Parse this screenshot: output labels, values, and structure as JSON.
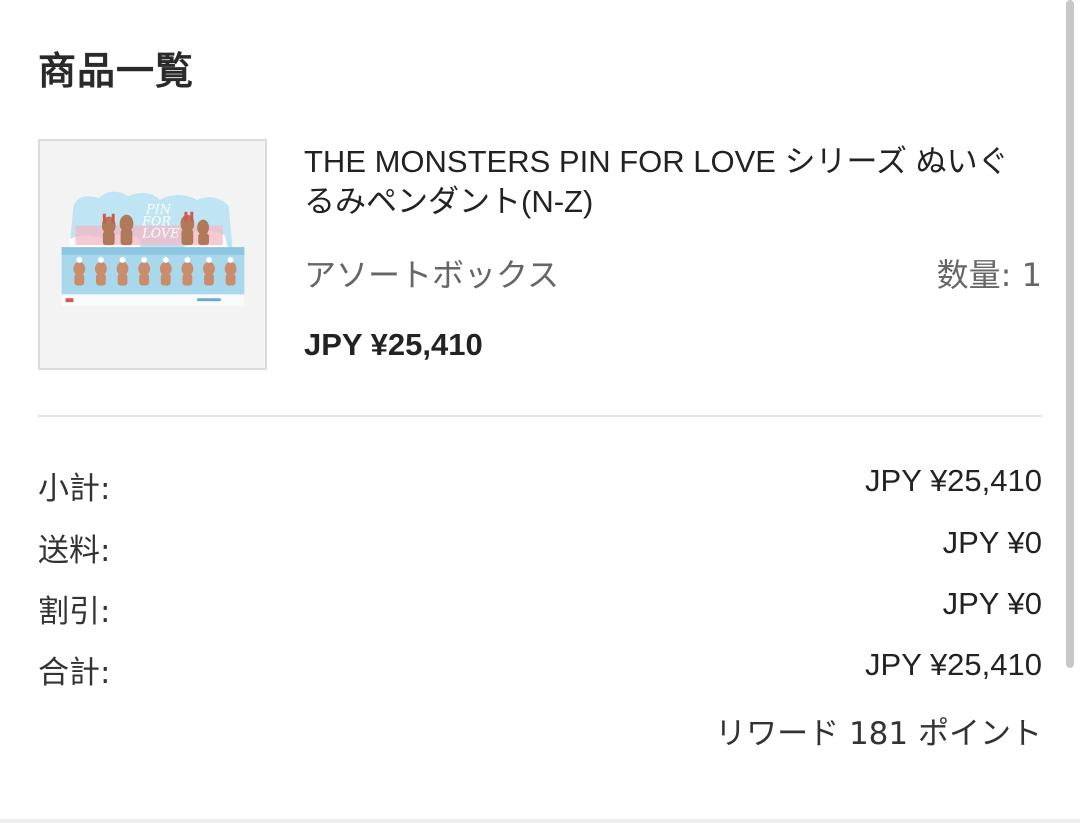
{
  "section": {
    "title": "商品一覧"
  },
  "product": {
    "image": {
      "box_text_1": "PIN",
      "box_text_2": "FOR",
      "box_text_3": "LOVE"
    },
    "name": "THE MONSTERS PIN FOR LOVE シリーズ ぬいぐるみペンダント(N-Z)",
    "variant": "アソートボックス",
    "quantity": "数量: 1",
    "price": "JPY ¥25,410"
  },
  "summary": {
    "subtotal_label": "小計:",
    "subtotal_value": "JPY ¥25,410",
    "shipping_label": "送料:",
    "shipping_value": "JPY ¥0",
    "discount_label": "割引:",
    "discount_value": "JPY ¥0",
    "total_label": "合計:",
    "total_value": "JPY ¥25,410",
    "reward": "リワード 181 ポイント"
  },
  "colors": {
    "box_sky": "#9fd3ea",
    "box_pink": "#f2b8c6",
    "box_white": "#f7fbfd",
    "figure": "#b07a58"
  }
}
